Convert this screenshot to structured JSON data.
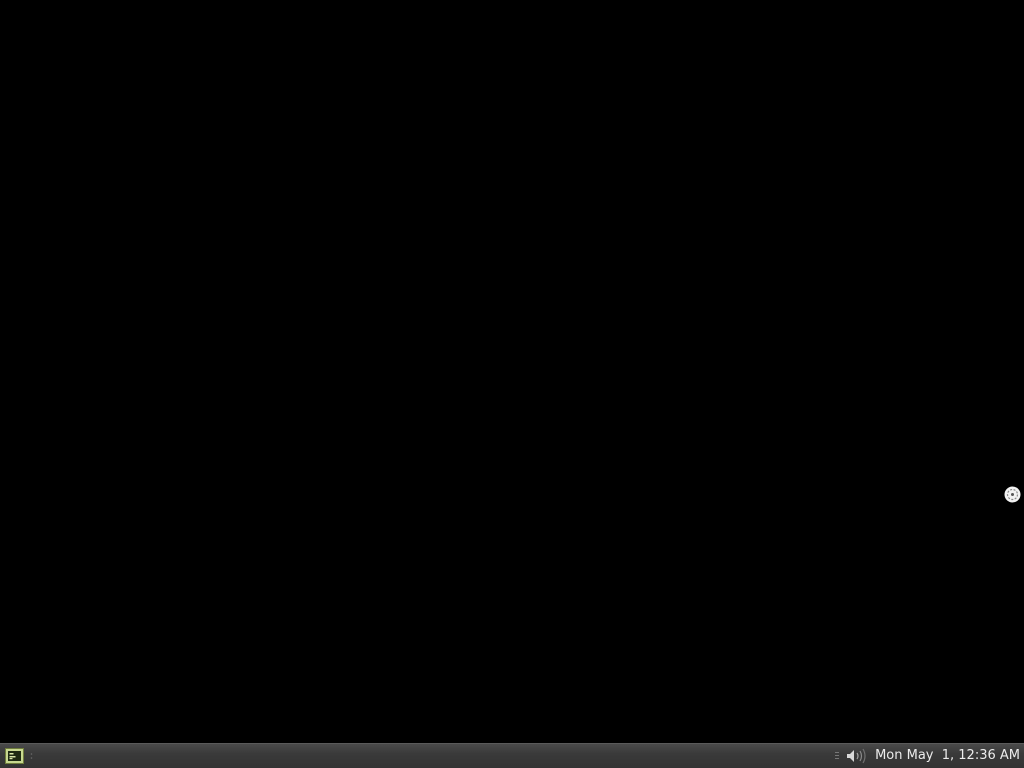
{
  "taskbar": {
    "menu_icon": "application-menu-icon",
    "clock": "Mon May  1, 12:36 AM",
    "volume_icon": "volume-icon"
  },
  "desktop": {
    "background_color": "#000000",
    "cursor_icon": "busy-cursor-icon"
  }
}
